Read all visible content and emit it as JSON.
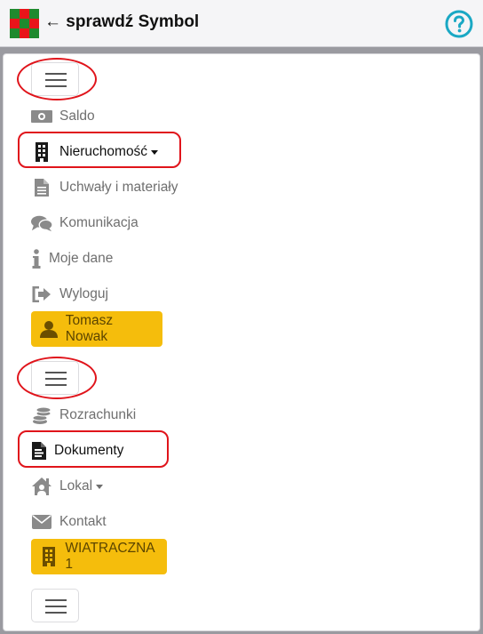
{
  "header": {
    "back_arrow": "←",
    "title": "sprawdź Symbol",
    "help_icon": "question-circle-icon",
    "accent": "#1aa8c4"
  },
  "menu1": {
    "items": [
      {
        "label": "Saldo",
        "icon": "money-icon"
      },
      {
        "label": "Nieruchomość",
        "icon": "building-icon"
      },
      {
        "label": "Uchwały i materiały",
        "icon": "document-icon"
      },
      {
        "label": "Komunikacja",
        "icon": "chat-icon"
      },
      {
        "label": "Moje dane",
        "icon": "info-icon"
      },
      {
        "label": "Wyloguj",
        "icon": "logout-icon"
      }
    ],
    "user_button": "Tomasz Nowak"
  },
  "menu2": {
    "items": [
      {
        "label": "Rozrachunki",
        "icon": "coins-icon"
      },
      {
        "label": "Dokumenty",
        "icon": "file-icon"
      },
      {
        "label": "Lokal",
        "icon": "home-user-icon"
      },
      {
        "label": "Kontakt",
        "icon": "envelope-icon"
      }
    ],
    "building_button": "WIATRACZNA 1"
  },
  "colors": {
    "warning_button": "#f5bd0c",
    "highlight_red": "#e0141b"
  }
}
